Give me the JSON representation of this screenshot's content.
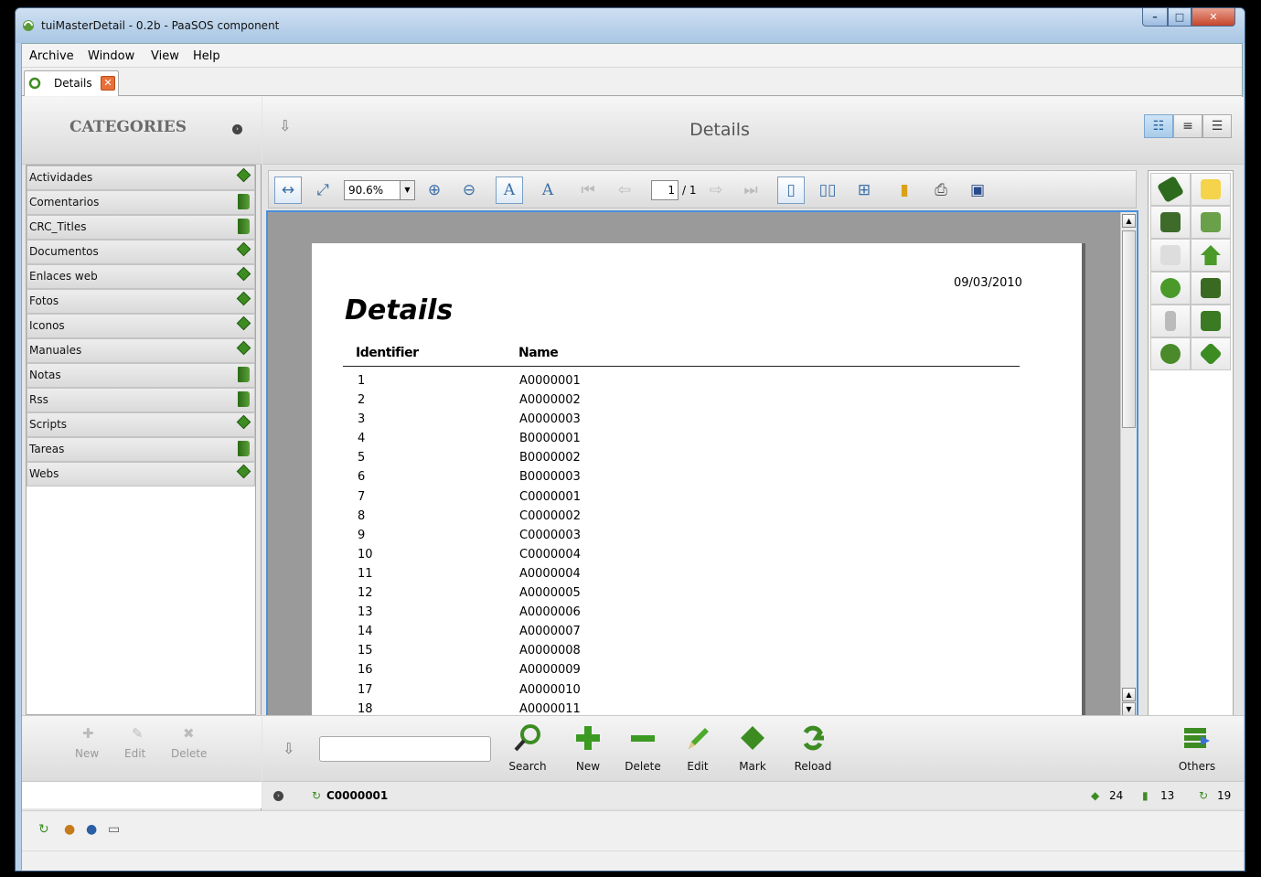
{
  "window": {
    "title": "tuiMasterDetail - 0.2b - PaaSOS component"
  },
  "menu": [
    "Archive",
    "Window",
    "View",
    "Help"
  ],
  "tab": {
    "label": "Details"
  },
  "left": {
    "header": "CATEGORIES",
    "categories": [
      {
        "label": "Actividades",
        "icon": "diamond"
      },
      {
        "label": "Comentarios",
        "icon": "book"
      },
      {
        "label": "CRC_Titles",
        "icon": "book"
      },
      {
        "label": "Documentos",
        "icon": "diamond"
      },
      {
        "label": "Enlaces web",
        "icon": "diamond"
      },
      {
        "label": "Fotos",
        "icon": "diamond"
      },
      {
        "label": "Iconos",
        "icon": "diamond"
      },
      {
        "label": "Manuales",
        "icon": "diamond"
      },
      {
        "label": "Notas",
        "icon": "book"
      },
      {
        "label": "Rss",
        "icon": "book"
      },
      {
        "label": "Scripts",
        "icon": "diamond"
      },
      {
        "label": "Tareas",
        "icon": "book"
      },
      {
        "label": "Webs",
        "icon": "diamond"
      }
    ],
    "actions": {
      "new": "New",
      "edit": "Edit",
      "delete": "Delete"
    }
  },
  "main": {
    "header": "Details",
    "zoom": "90.6%",
    "page_current": "1",
    "page_total": "/ 1"
  },
  "report": {
    "date": "09/03/2010",
    "title": "Details",
    "col_identifier": "Identifier",
    "col_name": "Name",
    "rows": [
      [
        "1",
        "A0000001"
      ],
      [
        "2",
        "A0000002"
      ],
      [
        "3",
        "A0000003"
      ],
      [
        "4",
        "B0000001"
      ],
      [
        "5",
        "B0000002"
      ],
      [
        "6",
        "B0000003"
      ],
      [
        "7",
        "C0000001"
      ],
      [
        "8",
        "C0000002"
      ],
      [
        "9",
        "C0000003"
      ],
      [
        "10",
        "C0000004"
      ],
      [
        "11",
        "A0000004"
      ],
      [
        "12",
        "A0000005"
      ],
      [
        "13",
        "A0000006"
      ],
      [
        "14",
        "A0000007"
      ],
      [
        "15",
        "A0000008"
      ],
      [
        "16",
        "A0000009"
      ],
      [
        "17",
        "A0000010"
      ],
      [
        "18",
        "A0000011"
      ]
    ]
  },
  "toolbar": {
    "search": "Search",
    "new": "New",
    "delete": "Delete",
    "edit": "Edit",
    "mark": "Mark",
    "reload": "Reload",
    "others": "Others"
  },
  "status": {
    "selected": "C0000001",
    "count_diamond": "24",
    "count_book": "13",
    "count_reload": "19"
  },
  "colors": {
    "accent": "#4a90d9",
    "green": "#3c8c22"
  }
}
